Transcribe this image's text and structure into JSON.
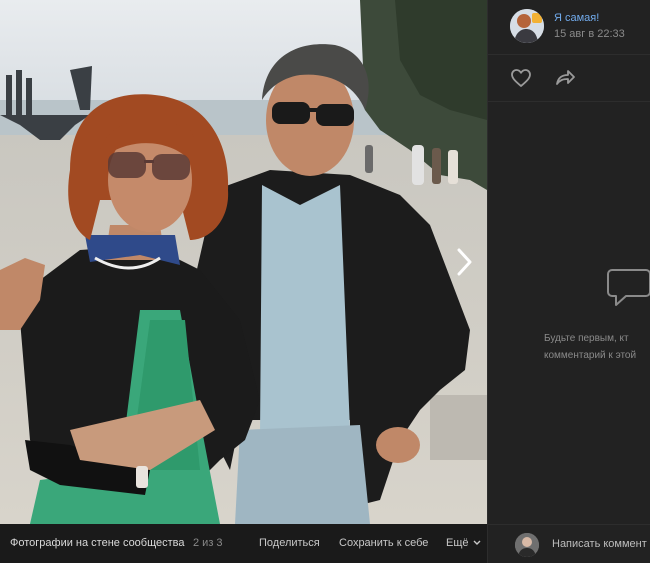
{
  "viewer": {
    "counter": "2 из 3",
    "album_title": "Фотографии на стене сообщества",
    "share_label": "Поделиться",
    "save_label": "Сохранить к себе",
    "more_label": "Ещё",
    "next_icon": "chevron-right-icon"
  },
  "post": {
    "author": "Я самая!",
    "date": "15 авг в 22:33",
    "like_icon": "heart-icon",
    "repost_icon": "share-arrow-icon"
  },
  "comments": {
    "empty_line1": "Будьте первым, кт",
    "empty_line2": "комментарий к этой",
    "input_placeholder": "Написать коммент"
  },
  "colors": {
    "background": "#1f1f1f",
    "link": "#71aaeb",
    "muted": "#8a8a8a"
  }
}
